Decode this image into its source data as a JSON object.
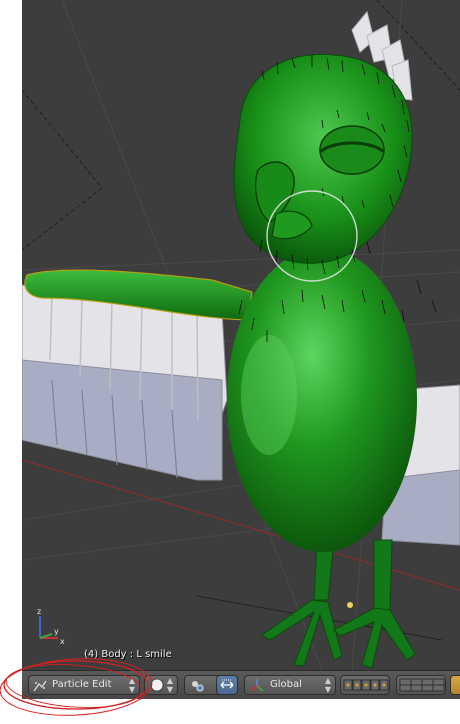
{
  "viewport": {
    "object_label": "(4) Body : L smile",
    "gizmo_axes": {
      "x": "x",
      "y": "y",
      "z": "z"
    }
  },
  "header": {
    "mode": {
      "label": "Particle Edit",
      "icon": "particle-edit-icon"
    },
    "shading": {
      "icon": "solid-sphere-icon"
    },
    "pivot": {
      "icon": "pivot-point-icon"
    },
    "manipulator": {
      "icon": "manipulator-arrows-icon"
    },
    "orientation": {
      "label": "Global",
      "icon": "transform-orientation-icon"
    },
    "select_mode": {
      "icon": "path-select-mode-icon"
    },
    "layers": {
      "icon": "layers-grid-icon"
    },
    "render": {
      "icon": "render-icon"
    }
  },
  "colors": {
    "viewport_bg": "#3d3d3d",
    "header_bg": "#505050",
    "bird_body": "#1c8c1c",
    "feathers": "#e6e6e8",
    "brush_circle": "#dcdcdc",
    "annotation": "#d42020",
    "axis_x": "#c83232",
    "axis_y": "#46a046",
    "axis_z": "#3c64d2"
  }
}
